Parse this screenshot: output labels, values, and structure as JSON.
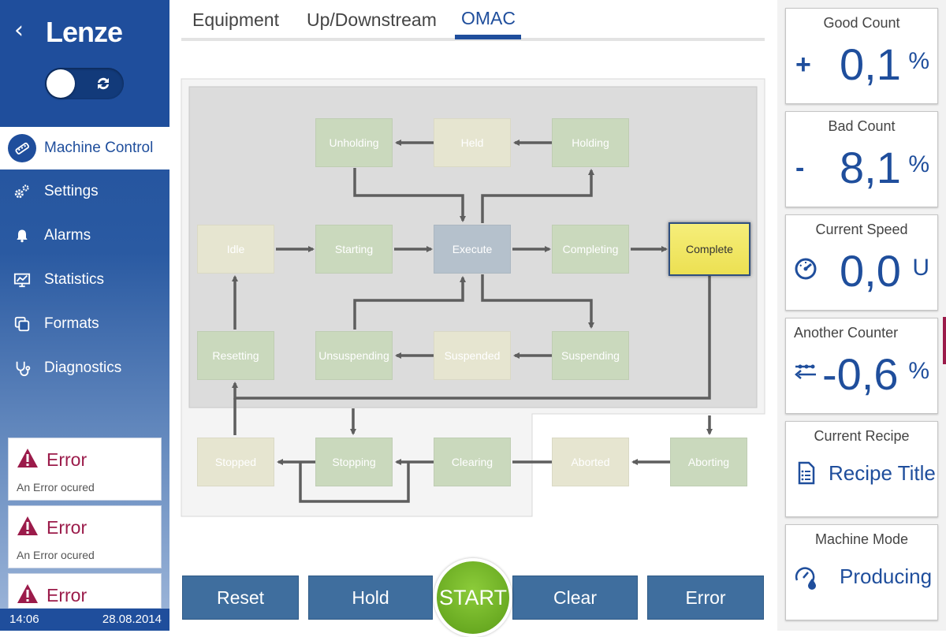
{
  "sidebar": {
    "brand": "Lenze",
    "back_glyph": "‹",
    "nav": [
      {
        "label": "Machine Control",
        "icon": "machine-control-icon"
      },
      {
        "label": "Settings",
        "icon": "gears-icon"
      },
      {
        "label": "Alarms",
        "icon": "bell-icon"
      },
      {
        "label": "Statistics",
        "icon": "chart-monitor-icon"
      },
      {
        "label": "Formats",
        "icon": "layers-icon"
      },
      {
        "label": "Diagnostics",
        "icon": "stethoscope-icon"
      }
    ],
    "errors": [
      {
        "title": "Error",
        "message": "An Error ocured"
      },
      {
        "title": "Error",
        "message": "An Error ocured"
      },
      {
        "title": "Error",
        "message": ""
      }
    ],
    "status": {
      "time": "14:06",
      "date": "28.08.2014"
    }
  },
  "tabs": [
    "Equipment",
    "Up/Downstream",
    "OMAC"
  ],
  "active_tab": "OMAC",
  "states": {
    "unholding": "Unholding",
    "held": "Held",
    "holding": "Holding",
    "idle": "Idle",
    "starting": "Starting",
    "execute": "Execute",
    "completing": "Completing",
    "complete": "Complete",
    "resetting": "Resetting",
    "unsuspending": "Unsuspending",
    "suspended": "Suspended",
    "suspending": "Suspending",
    "stopped": "Stopped",
    "stopping": "Stopping",
    "clearing": "Clearing",
    "aborted": "Aborted",
    "aborting": "Aborting"
  },
  "current_state": "Complete",
  "buttons": {
    "reset": "Reset",
    "hold": "Hold",
    "start": "START",
    "clear": "Clear",
    "error": "Error"
  },
  "cards": {
    "good_count": {
      "title": "Good Count",
      "sign": "+",
      "value": "0,1",
      "unit": "%"
    },
    "bad_count": {
      "title": "Bad Count",
      "sign": "-",
      "value": "8,1",
      "unit": "%"
    },
    "current_speed": {
      "title": "Current Speed",
      "value": "0,0",
      "unit": "U",
      "icon": "speedometer-icon"
    },
    "another_counter": {
      "title": "Another Counter",
      "value": "-0,6",
      "unit": "%",
      "icon": "transfer-icon"
    },
    "current_recipe": {
      "title": "Current Recipe",
      "value": "Recipe Title",
      "icon": "document-icon"
    },
    "machine_mode": {
      "title": "Machine Mode",
      "value": "Producing",
      "icon": "gauge-drop-icon"
    }
  },
  "colors": {
    "brand_blue": "#1f4e9c",
    "error_red": "#9b1b4a",
    "start_green": "#6aab22",
    "complete_yellow": "#f1e663",
    "button_blue": "#3f6e9e"
  }
}
